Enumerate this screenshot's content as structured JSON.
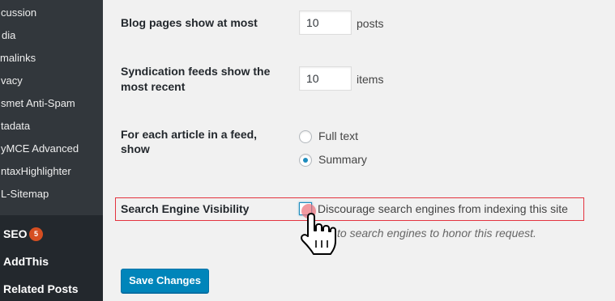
{
  "sidebar": {
    "submenu": [
      "cussion",
      "dia",
      "malinks",
      "vacy",
      "smet Anti-Spam",
      "tadata",
      "yMCE Advanced",
      "ntaxHighlighter",
      "L-Sitemap"
    ],
    "menu": [
      {
        "label": "SEO",
        "badge": "5"
      },
      {
        "label": "AddThis"
      },
      {
        "label": "Related Posts"
      }
    ]
  },
  "settings": {
    "blog_pages": {
      "label": "Blog pages show at most",
      "value": "10",
      "unit": "posts"
    },
    "syndication": {
      "label_line1": "Syndication feeds show the",
      "label_line2": "most recent",
      "value": "10",
      "unit": "items"
    },
    "feed_article": {
      "label_line1": "For each article in a feed,",
      "label_line2": "show",
      "options": [
        "Full text",
        "Summary"
      ],
      "selected": "Summary"
    },
    "visibility": {
      "label": "Search Engine Visibility",
      "checkbox_label": "Discourage search engines from indexing this site",
      "description": "to search engines to honor this request."
    }
  },
  "actions": {
    "save_label": "Save Changes"
  },
  "colors": {
    "sidebar_bg": "#23282d",
    "submenu_bg": "#32373c",
    "primary": "#0085ba",
    "highlight_border": "#e4333f",
    "badge": "#d54e21"
  },
  "icons": {
    "cursor": "hand-pointer-icon"
  }
}
